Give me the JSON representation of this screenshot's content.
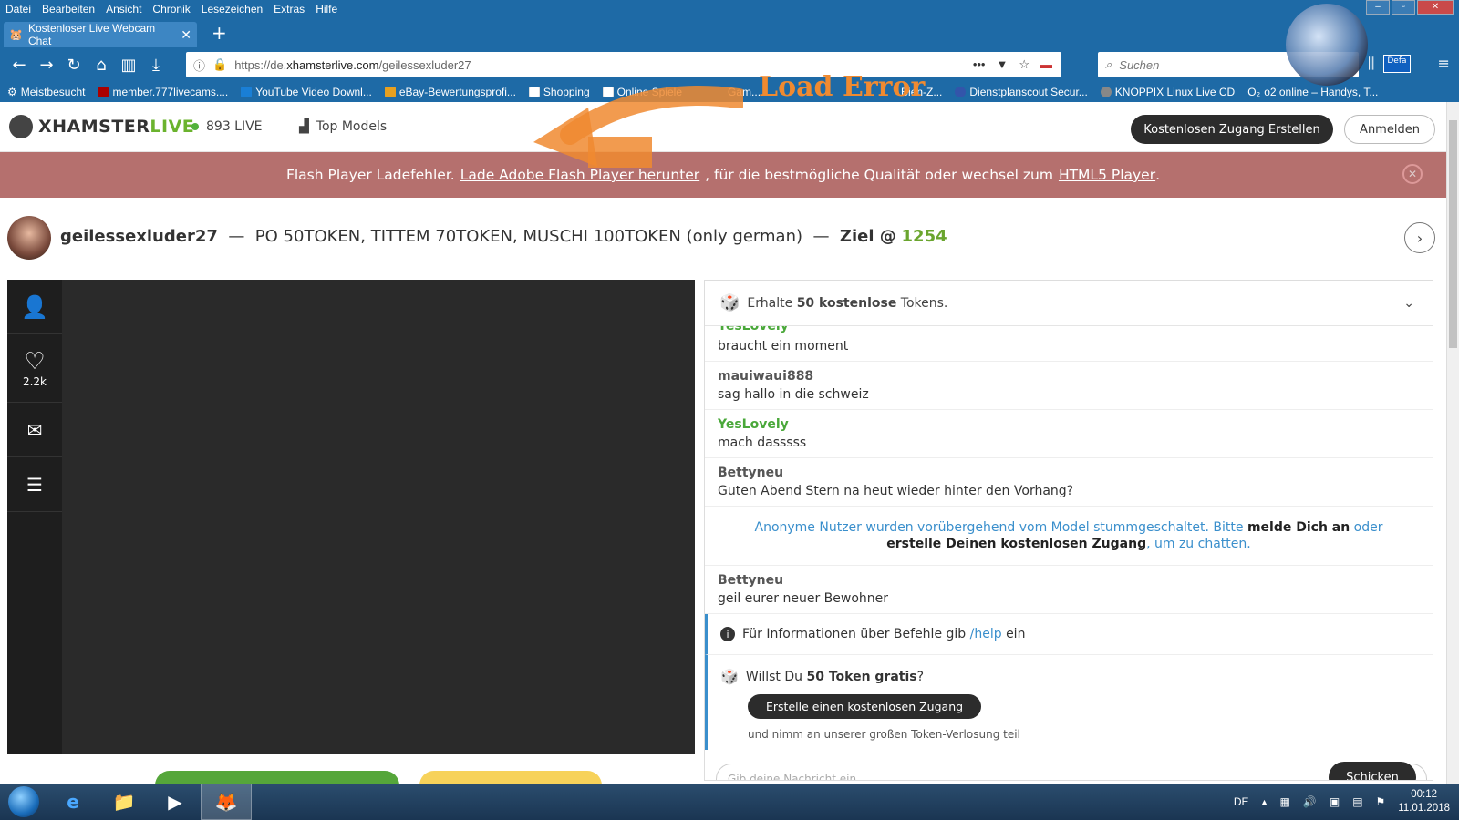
{
  "browser": {
    "menu": [
      "Datei",
      "Bearbeiten",
      "Ansicht",
      "Chronik",
      "Lesezeichen",
      "Extras",
      "Hilfe"
    ],
    "tab_title": "Kostenloser Live Webcam Chat",
    "url_prefix": "https://de.",
    "url_host": "xhamsterlive.com",
    "url_path": "/geilessexluder27",
    "search_placeholder": "Suchen",
    "defa_badge": "Defa",
    "bookmarks": [
      "Meistbesucht",
      "member.777livecams....",
      "YouTube Video Downl...",
      "eBay-Bewertungsprofi...",
      "Shopping",
      "Online Spiele",
      "Gam...",
      "Bien-Z...",
      "Dienstplanscout Secur...",
      "KNOPPIX Linux Live CD",
      "o2 online – Handys, T..."
    ]
  },
  "annotation": {
    "load_error": "Load Error",
    "arrow_color": "#f08a30"
  },
  "site": {
    "logo_part1": "XHAMSTER",
    "logo_part2": "LIVE",
    "live_count": "893 LIVE",
    "top_models": "Top Models",
    "create_account": "Kostenlosen Zugang Erstellen",
    "login": "Anmelden"
  },
  "flash_banner": {
    "text1": "Flash Player Ladefehler.",
    "link1": "Lade Adobe Flash Player herunter",
    "text2": ", für die bestmögliche Qualität oder wechsel zum",
    "link2": "HTML5 Player",
    "text3": "."
  },
  "room": {
    "username": "geilessexluder27",
    "sep1": "—",
    "topic": "PO 50TOKEN, TITTEM 70TOKEN, MUSCHI 100TOKEN (only german)",
    "sep2": "—",
    "goal_label": "Ziel @",
    "goal_value": "1254"
  },
  "sidebar": {
    "likes": "2.2k"
  },
  "chat": {
    "header_pre": "Erhalte",
    "header_bold": "50 kostenlose",
    "header_post": "Tokens.",
    "messages": [
      {
        "user": "YesLovely",
        "text": "braucht ein moment"
      },
      {
        "user": "mauiwaui888",
        "text": "sag hallo in die schweiz"
      },
      {
        "user": "YesLovely",
        "text": "mach dasssss"
      },
      {
        "user": "Bettyneu",
        "text": "Guten Abend Stern na heut wieder hinter den Vorhang?"
      }
    ],
    "notice": {
      "t1": "Anonyme Nutzer wurden vorübergehend vom Model stummgeschaltet. Bitte",
      "b1": "melde Dich an",
      "t2": "oder",
      "b2": "erstelle Deinen kostenlosen Zugang",
      "t3": ", um zu chatten."
    },
    "after_notice": {
      "user": "Bettyneu",
      "text": "geil eurer neuer Bewohner"
    },
    "info_pre": "Für Informationen über Befehle gib",
    "info_cmd": "/help",
    "info_post": "ein",
    "promo_pre": "Willst Du",
    "promo_bold": "50 Token gratis",
    "promo_post": "?",
    "promo_button": "Erstelle einen kostenlosen Zugang",
    "promo_small": "und nimm an unserer großen Token-Verlosung teil",
    "input_placeholder": "Gib deine Nachricht ein",
    "send": "Schicken"
  },
  "taskbar": {
    "lang": "DE",
    "time": "00:12",
    "date": "11.01.2018"
  },
  "colors": {
    "browser_chrome": "#1e6aa6",
    "flash_banner": "#b5706e",
    "accent_green": "#6bb32e",
    "link_blue": "#3a8fcc"
  }
}
